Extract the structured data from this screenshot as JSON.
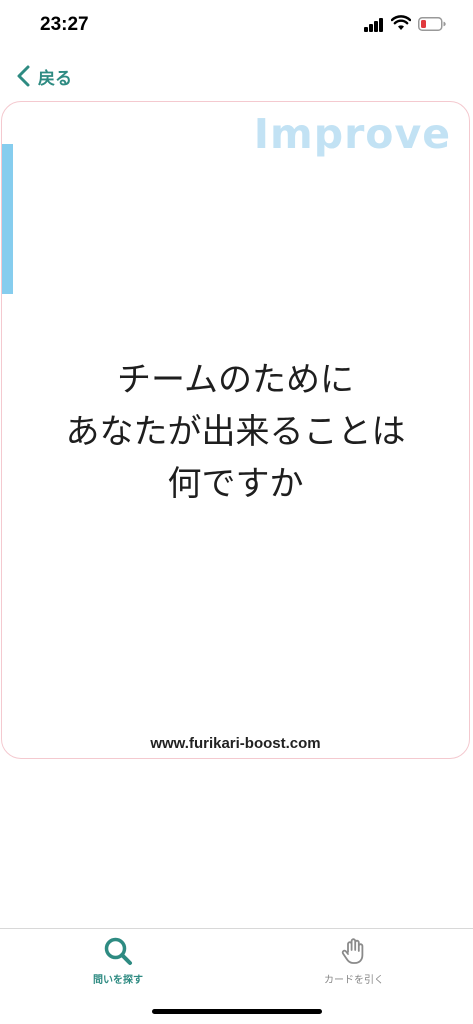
{
  "status_bar": {
    "time": "23:27",
    "battery_color": "#e0393e"
  },
  "nav": {
    "back_label": "戻る",
    "accent_color": "#2e8b82"
  },
  "card": {
    "category": "Improve",
    "question_lines": [
      "チームのために",
      "あなたが出来ることは",
      "何ですか"
    ],
    "url": "www.furikari-boost.com",
    "border_color": "#f4c9cf",
    "accent_color": "#86cdee"
  },
  "tab_bar": {
    "tabs": [
      {
        "label": "問いを探す",
        "icon": "search-icon",
        "active": true
      },
      {
        "label": "カードを引く",
        "icon": "hand-icon",
        "active": false
      }
    ]
  }
}
